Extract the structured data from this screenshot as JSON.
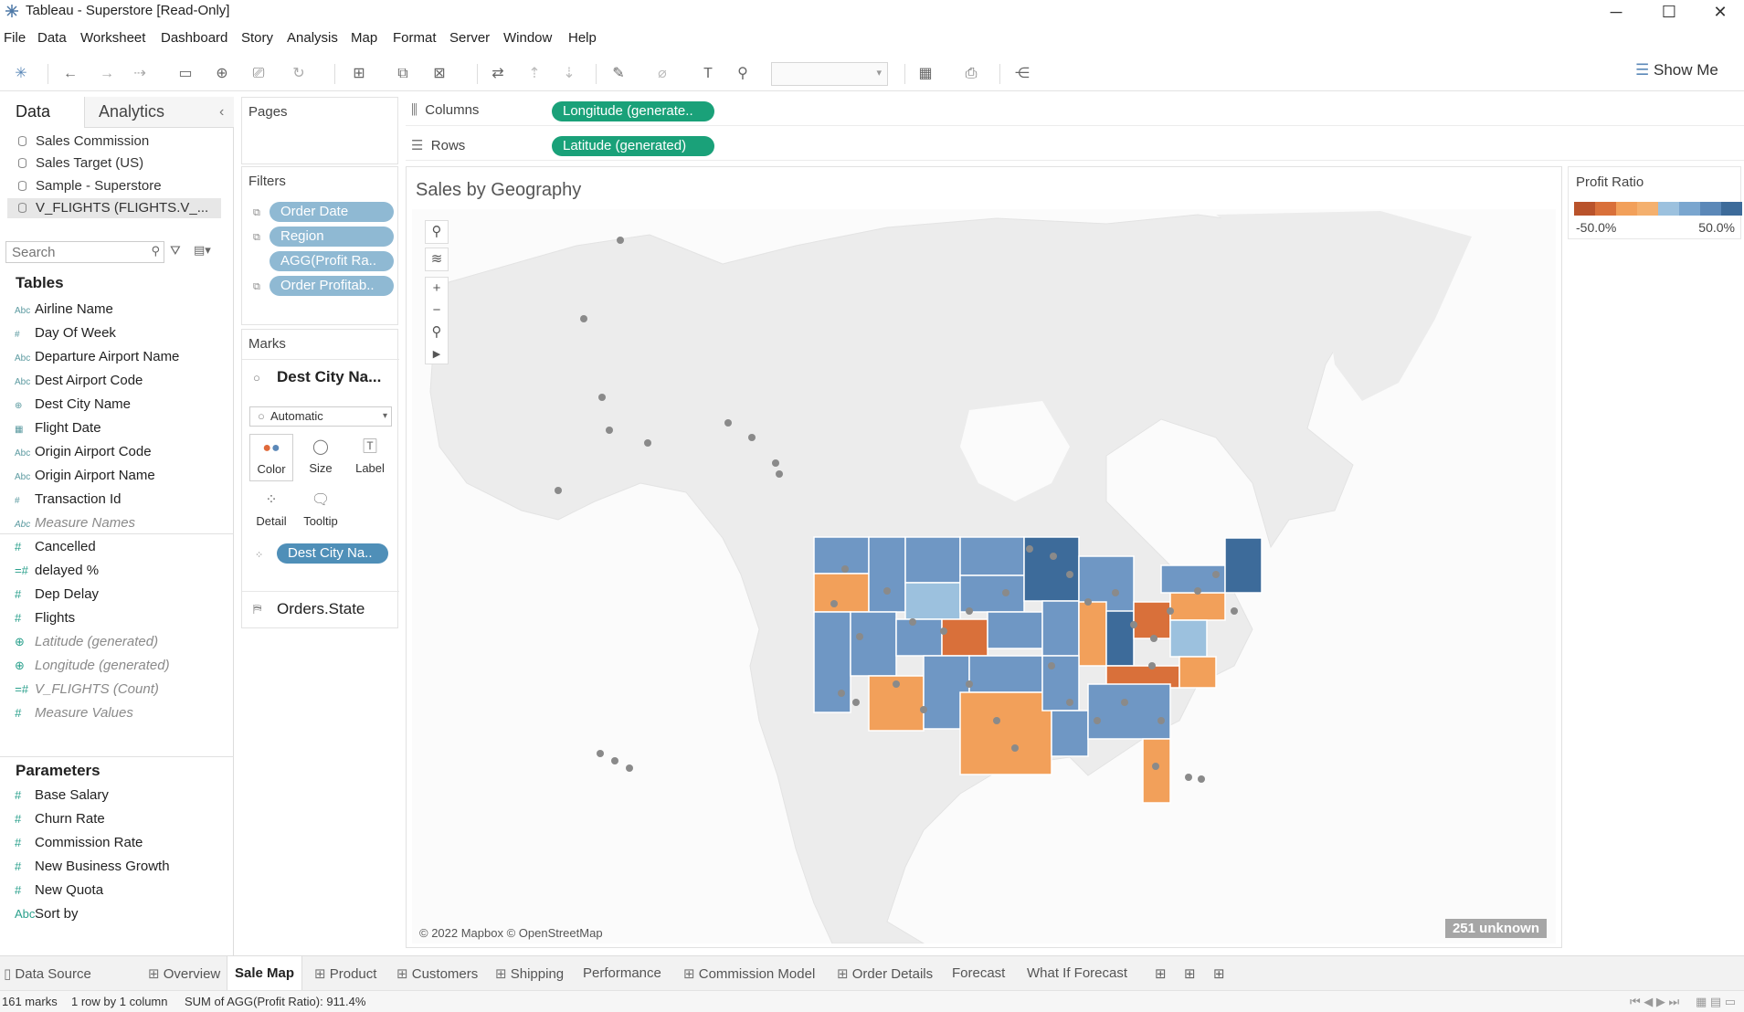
{
  "window": {
    "title": "Tableau - Superstore [Read-Only]"
  },
  "menu": [
    "File",
    "Data",
    "Worksheet",
    "Dashboard",
    "Story",
    "Analysis",
    "Map",
    "Format",
    "Server",
    "Window",
    "Help"
  ],
  "toolbar": {
    "show_me": "Show Me"
  },
  "data_pane": {
    "tab_data": "Data",
    "tab_analytics": "Analytics",
    "datasources": [
      "Sales Commission",
      "Sales Target (US)",
      "Sample - Superstore",
      "V_FLIGHTS (FLIGHTS.V_..."
    ],
    "search_placeholder": "Search",
    "tables_header": "Tables",
    "dimensions": [
      {
        "name": "Airline Name",
        "type": "Abc"
      },
      {
        "name": "Day Of Week",
        "type": "#"
      },
      {
        "name": "Departure Airport Name",
        "type": "Abc"
      },
      {
        "name": "Dest Airport Code",
        "type": "Abc"
      },
      {
        "name": "Dest City Name",
        "type": "geo"
      },
      {
        "name": "Flight Date",
        "type": "date"
      },
      {
        "name": "Origin Airport Code",
        "type": "Abc"
      },
      {
        "name": "Origin Airport Name",
        "type": "Abc"
      },
      {
        "name": "Transaction Id",
        "type": "#"
      },
      {
        "name": "Measure Names",
        "type": "Abc"
      }
    ],
    "measures": [
      {
        "name": "Cancelled",
        "type": "#"
      },
      {
        "name": "delayed %",
        "type": "=#"
      },
      {
        "name": "Dep Delay",
        "type": "#"
      },
      {
        "name": "Flights",
        "type": "#"
      },
      {
        "name": "Latitude (generated)",
        "type": "geo"
      },
      {
        "name": "Longitude (generated)",
        "type": "geo"
      },
      {
        "name": "V_FLIGHTS (Count)",
        "type": "=#"
      },
      {
        "name": "Measure Values",
        "type": "#"
      }
    ],
    "parameters_header": "Parameters",
    "parameters": [
      {
        "name": "Base Salary",
        "type": "#"
      },
      {
        "name": "Churn Rate",
        "type": "#"
      },
      {
        "name": "Commission Rate",
        "type": "#"
      },
      {
        "name": "New Business Growth",
        "type": "#"
      },
      {
        "name": "New Quota",
        "type": "#"
      },
      {
        "name": "Sort by",
        "type": "Abc"
      }
    ]
  },
  "pages": {
    "header": "Pages"
  },
  "filters": {
    "header": "Filters",
    "items": [
      "Order Date",
      "Region",
      "AGG(Profit Ra..",
      "Order Profitab.."
    ]
  },
  "marks": {
    "header": "Marks",
    "layer": "Dest City Na...",
    "type": "Automatic",
    "buttons": [
      "Color",
      "Size",
      "Label",
      "Detail",
      "Tooltip"
    ],
    "detail_pill": "Dest City Na..",
    "layer2": "Orders.State"
  },
  "shelves": {
    "columns_label": "Columns",
    "columns_pill": "Longitude (generate..",
    "rows_label": "Rows",
    "rows_pill": "Latitude (generated)"
  },
  "viz": {
    "title": "Sales by Geography",
    "copyright": "© 2022 Mapbox © OpenStreetMap",
    "unknown": "251 unknown"
  },
  "legend": {
    "title": "Profit Ratio",
    "min": "-50.0%",
    "max": "50.0%",
    "colors": [
      "#b9532b",
      "#d9703a",
      "#f2a05a",
      "#f4b06e",
      "#9cc1de",
      "#7aa6cf",
      "#5b88b8",
      "#3d6b9a"
    ]
  },
  "sheet_tabs": [
    "Data Source",
    "Overview",
    "Sale Map",
    "Product",
    "Customers",
    "Shipping",
    "Performance",
    "Commission Model",
    "Order Details",
    "Forecast",
    "What If Forecast"
  ],
  "active_tab": "Sale Map",
  "status": {
    "marks": "161 marks",
    "rows": "1 row by 1 column",
    "sum": "SUM of AGG(Profit Ratio): 911.4%"
  },
  "colors": {
    "green_pill": "#1aa179",
    "blue_pill": "#4f8fb8",
    "state_blue": "#6f97c4",
    "state_orange": "#f2a05a",
    "state_dark_orange": "#d9703a"
  }
}
